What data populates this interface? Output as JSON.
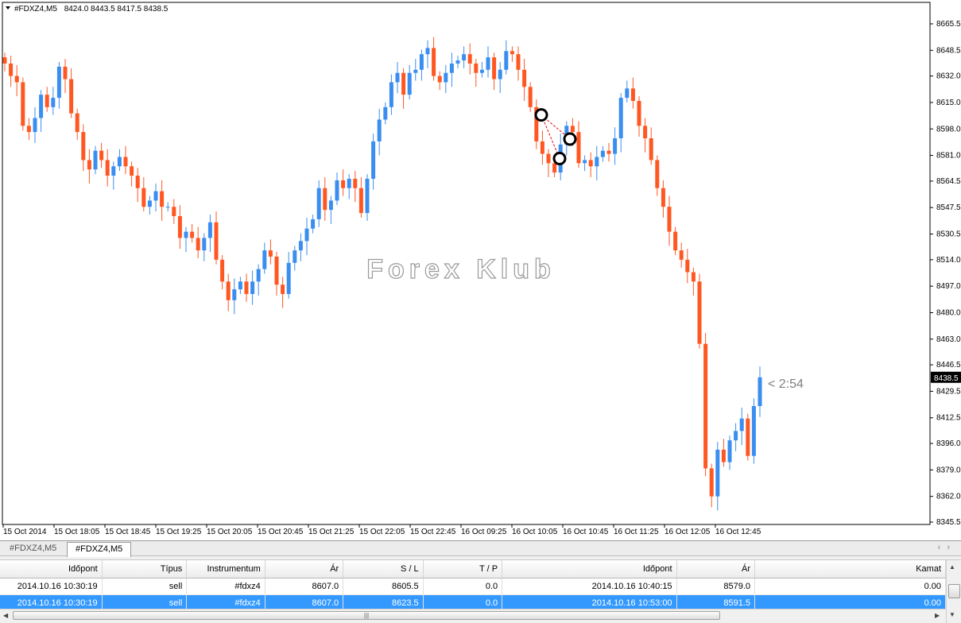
{
  "chart": {
    "symbol_label": "#FDXZ4,M5",
    "ohlc": "8424.0 8443.5 8417.5 8438.5",
    "watermark": "Forex Klub",
    "price_ticks": [
      "8665.5",
      "8648.5",
      "8632.0",
      "8615.0",
      "8598.0",
      "8581.0",
      "8564.5",
      "8547.5",
      "8530.5",
      "8514.0",
      "8497.0",
      "8480.0",
      "8463.0",
      "8446.5",
      "8429.5",
      "8412.5",
      "8396.0",
      "8379.0",
      "8362.0",
      "8345.5"
    ],
    "current_price": "8438.5",
    "countdown": "< 2:54",
    "time_labels": [
      "15 Oct 2014",
      "15 Oct 18:05",
      "15 Oct 18:45",
      "15 Oct 19:25",
      "15 Oct 20:05",
      "15 Oct 20:45",
      "15 Oct 21:25",
      "15 Oct 22:05",
      "15 Oct 22:45",
      "16 Oct 09:25",
      "16 Oct 10:05",
      "16 Oct 10:45",
      "16 Oct 11:25",
      "16 Oct 12:05",
      "16 Oct 12:45"
    ],
    "colors": {
      "bull": "#3a8ef0",
      "bear": "#ff5722",
      "grid_bg": "#ffffff",
      "axis": "#000000"
    }
  },
  "chart_data": {
    "type": "candlestick",
    "ylim": [
      8345.5,
      8672
    ],
    "close_path": [
      8640,
      8632,
      8628,
      8600,
      8596,
      8605,
      8620,
      8612,
      8618,
      8638,
      8630,
      8608,
      8596,
      8578,
      8572,
      8584,
      8578,
      8568,
      8574,
      8580,
      8574,
      8568,
      8560,
      8548,
      8552,
      8558,
      8548,
      8548,
      8542,
      8528,
      8532,
      8528,
      8520,
      8528,
      8538,
      8514,
      8500,
      8488,
      8495,
      8500,
      8492,
      8500,
      8508,
      8520,
      8516,
      8498,
      8492,
      8512,
      8520,
      8526,
      8534,
      8540,
      8560,
      8546,
      8552,
      8565,
      8560,
      8566,
      8560,
      8544,
      8566,
      8590,
      8604,
      8612,
      8628,
      8634,
      8620,
      8634,
      8636,
      8646,
      8650,
      8632,
      8628,
      8634,
      8640,
      8642,
      8646,
      8640,
      8634,
      8636,
      8644,
      8630,
      8636,
      8648,
      8646,
      8636,
      8625,
      8612,
      8590,
      8582,
      8576,
      8570,
      8588,
      8600,
      8596,
      8576,
      8578,
      8574,
      8580,
      8584,
      8582,
      8592,
      8618,
      8624,
      8616,
      8600,
      8592,
      8578,
      8560,
      8548,
      8532,
      8520,
      8514,
      8506,
      8500,
      8460,
      8380,
      8362,
      8392,
      8384,
      8398,
      8404,
      8412,
      8388,
      8420,
      8438.5
    ],
    "current_price": 8438.5
  },
  "tabs": [
    {
      "label": "#FDXZ4,M5",
      "active": false
    },
    {
      "label": "#FDXZ4,M5",
      "active": true
    }
  ],
  "trades": {
    "columns": [
      "Időpont",
      "Típus",
      "Instrumentum",
      "Ár",
      "S / L",
      "T / P",
      "Időpont",
      "Ár",
      "Kamat"
    ],
    "rows": [
      [
        "2014.10.16 10:30:19",
        "sell",
        "#fdxz4",
        "8607.0",
        "8605.5",
        "0.0",
        "2014.10.16 10:40:15",
        "8579.0",
        "0.00"
      ],
      [
        "2014.10.16 10:30:19",
        "sell",
        "#fdxz4",
        "8607.0",
        "8623.5",
        "0.0",
        "2014.10.16 10:53:00",
        "8591.5",
        "0.00"
      ]
    ],
    "selected_row": 1
  }
}
